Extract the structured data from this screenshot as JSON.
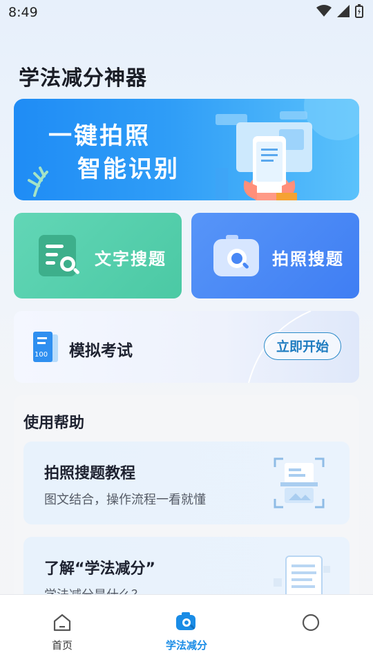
{
  "status_bar": {
    "time": "8:49"
  },
  "page": {
    "title": "学法减分神器"
  },
  "banner": {
    "line1": "一键拍照",
    "line2": "智能识别"
  },
  "actions": [
    {
      "label": "文字搜题",
      "icon": "text-search-icon",
      "color": "#52cda9"
    },
    {
      "label": "拍照搜题",
      "icon": "camera-search-icon",
      "color": "#4887f5"
    }
  ],
  "exam": {
    "label": "模拟考试",
    "button": "立即开始",
    "icon_number": "100"
  },
  "help": {
    "title": "使用帮助",
    "items": [
      {
        "title": "拍照搜题教程",
        "desc": "图文结合，操作流程一看就懂"
      },
      {
        "title": "了解“学法减分”",
        "desc": "学法减分是什么？"
      }
    ]
  },
  "tabs": [
    {
      "label": "首页",
      "icon": "home-icon"
    },
    {
      "label": "学法减分",
      "icon": "camera-icon",
      "active": true
    },
    {
      "label": "",
      "icon": "profile-icon"
    }
  ],
  "colors": {
    "accent": "#1a8ce6",
    "green": "#52cda9",
    "blue": "#4887f5"
  }
}
